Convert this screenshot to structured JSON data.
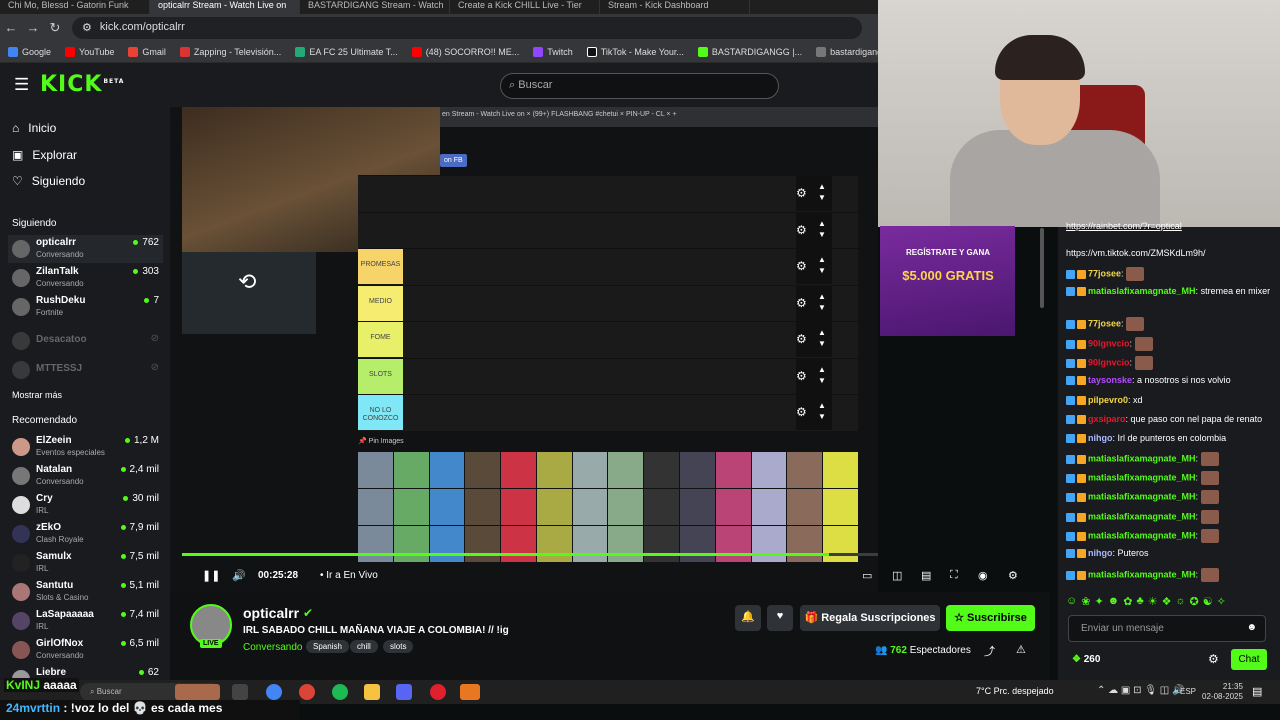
{
  "browser": {
    "tabs": [
      "Chi Mo, Blessd - Gatorin Funk",
      "opticalrr Stream - Watch Live on",
      "BASTARDIGANG Stream - Watch",
      "Create a Kick CHILL Live - Tier",
      "Stream - Kick Dashboard"
    ],
    "url": "kick.com/opticalrr",
    "bookmarks": [
      "Google",
      "YouTube",
      "Gmail",
      "Zapping - Televisión...",
      "EA FC 25 Ultimate T...",
      "(48) SOCORRO!! ME...",
      "Twitch",
      "TikTok - Make Your...",
      "BASTARDIGANGG |...",
      "bastardigangg - Kic..."
    ]
  },
  "header": {
    "logo": "KICK",
    "logo_sup": "BETA",
    "search_placeholder": "Buscar"
  },
  "sidebar": {
    "nav": [
      {
        "label": "Inicio",
        "icon": "home-icon"
      },
      {
        "label": "Explorar",
        "icon": "browse-icon"
      },
      {
        "label": "Siguiendo",
        "icon": "heart-icon"
      }
    ],
    "following_title": "Siguiendo",
    "following": [
      {
        "name": "opticalrr",
        "game": "Conversando",
        "viewers": "762",
        "live": true
      },
      {
        "name": "ZilanTalk",
        "game": "Conversando",
        "viewers": "303",
        "live": true
      },
      {
        "name": "RushDeku",
        "game": "Fortnite",
        "viewers": "7",
        "live": true
      },
      {
        "name": "Desacatoo",
        "game": "",
        "viewers": "",
        "live": false
      },
      {
        "name": "MTTESSJ",
        "game": "",
        "viewers": "",
        "live": false
      }
    ],
    "show_more": "Mostrar más",
    "recommended_title": "Recomendado",
    "recommended": [
      {
        "name": "ElZeein",
        "game": "Eventos especiales",
        "viewers": "1,2 M"
      },
      {
        "name": "Natalan",
        "game": "Conversando",
        "viewers": "2,4 mil"
      },
      {
        "name": "Cry",
        "game": "IRL",
        "viewers": "30 mil"
      },
      {
        "name": "zEkO",
        "game": "Clash Royale",
        "viewers": "7,9 mil"
      },
      {
        "name": "Samulx",
        "game": "IRL",
        "viewers": "7,5 mil"
      },
      {
        "name": "Santutu",
        "game": "Slots & Casino",
        "viewers": "5,1 mil"
      },
      {
        "name": "LaSapaaaaa",
        "game": "IRL",
        "viewers": "7,4 mil"
      },
      {
        "name": "GirlOfNox",
        "game": "Conversando",
        "viewers": "6,5 mil"
      },
      {
        "name": "Liebre",
        "game": "",
        "viewers": "62"
      }
    ]
  },
  "video": {
    "screen_tabs": "en Stream - Watch Live on  ×   (99+) FLASHBANG #chetui  ×   PIN-UP - CL  ×   +",
    "fb_badge": "on FB",
    "tiers": [
      {
        "label": ""
      },
      {
        "label": ""
      },
      {
        "label": "PROMESAS",
        "color": "#f7d46a"
      },
      {
        "label": "MEDIO",
        "color": "#f5ec70"
      },
      {
        "label": "FOME",
        "color": "#e8f06a"
      },
      {
        "label": "SLOTS",
        "color": "#b6ee6c"
      },
      {
        "label": "NO LO CONOZCO",
        "color": "#7fe7f5"
      }
    ],
    "pin_images": "📌 Pin Images",
    "progress": 0.75,
    "time": "00:25:28",
    "go_live": "Ir a En Vivo"
  },
  "ad": {
    "title": "REGÍSTRATE Y GANA",
    "amount": "$5.000 GRATIS"
  },
  "stream": {
    "name": "opticalrr",
    "title": "IRL SABADO CHILL MAÑANA VIAJE A COLOMBIA! // !ig",
    "category": "Conversando",
    "tags": [
      "Spanish",
      "chill",
      "slots"
    ],
    "live_badge": "LIVE",
    "gift_label": "Regala Suscripciones",
    "subscribe_label": "Suscribirse",
    "viewers": "762",
    "viewers_label": "Espectadores"
  },
  "chat": {
    "top_link": "https://rainbet.com/?r=optical",
    "messages": [
      {
        "user": "",
        "text": "https://vm.tiktok.com/ZMSKdLm9h/",
        "color": "#fff"
      },
      {
        "user": "77josee",
        "text": "",
        "color": "#f5d742"
      },
      {
        "user": "matiaslafixamagnate_MH",
        "text": "stremea en mixer",
        "color": "#53fc18"
      },
      {
        "user": "77josee",
        "text": "",
        "color": "#f5d742"
      },
      {
        "user": "90lgnvcio",
        "text": "",
        "color": "#e9162b"
      },
      {
        "user": "90lgnvcio",
        "text": "",
        "color": "#e9162b"
      },
      {
        "user": "taysonske",
        "text": "a nosotros si nos volvio",
        "color": "#b44cff"
      },
      {
        "user": "pilpevro0",
        "text": "xd",
        "color": "#f5d742"
      },
      {
        "user": "gxsiparo",
        "text": "que paso con nel papa de renato",
        "color": "#e9162b"
      },
      {
        "user": "nihgo",
        "text": "Irl de punteros en colombia",
        "color": "#aabbff"
      },
      {
        "user": "matiaslafixamagnate_MH",
        "text": "",
        "color": "#53fc18"
      },
      {
        "user": "matiaslafixamagnate_MH",
        "text": "",
        "color": "#53fc18"
      },
      {
        "user": "matiaslafixamagnate_MH",
        "text": "",
        "color": "#53fc18"
      },
      {
        "user": "matiaslafixamagnate_MH",
        "text": "",
        "color": "#53fc18"
      },
      {
        "user": "matiaslafixamagnate_MH",
        "text": "",
        "color": "#53fc18"
      },
      {
        "user": "nihgo",
        "text": "Puteros",
        "color": "#aabbff"
      },
      {
        "user": "matiaslafixamagnate_MH",
        "text": "",
        "color": "#53fc18"
      }
    ],
    "input_placeholder": "Enviar un mensaje",
    "points": "260",
    "send_label": "Chat"
  },
  "taskbar": {
    "search": "Buscar",
    "weather": "7°C  Prc. despejado",
    "lang": "ESP",
    "time": "21:35",
    "date": "02-08-2025"
  },
  "overlay": {
    "kvinj": "KvINJ",
    "kvinj_text": "aaaaa",
    "user": "24mvrttin",
    "text": "!voz lo del 💀 es cada mes"
  }
}
